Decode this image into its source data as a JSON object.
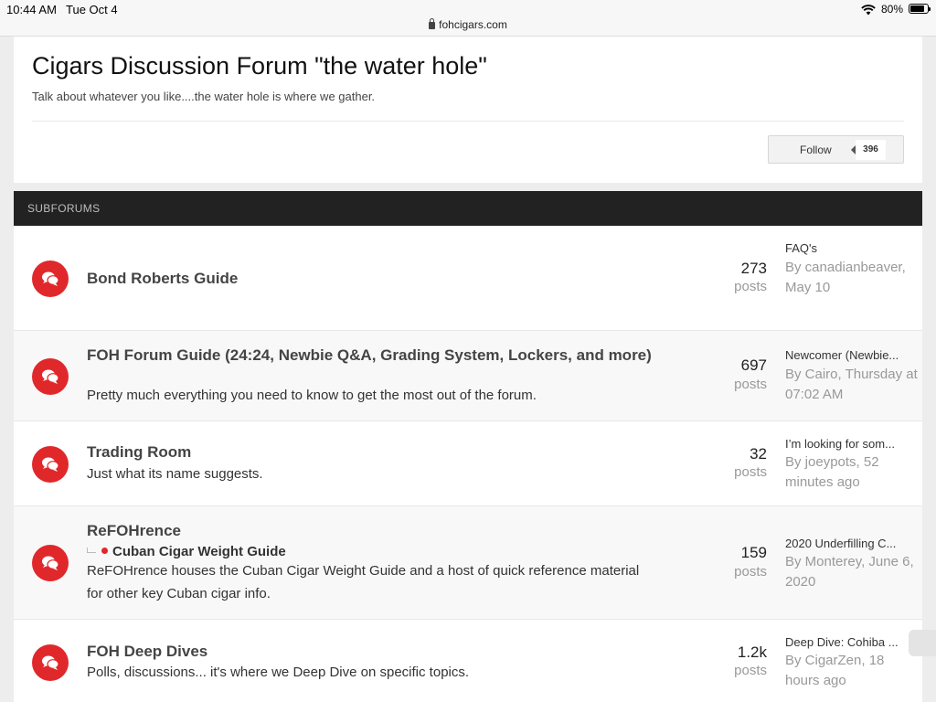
{
  "status_bar": {
    "time": "10:44 AM",
    "date": "Tue Oct 4",
    "url": "fohcigars.com",
    "battery": "80%"
  },
  "forum": {
    "title": "Cigars Discussion Forum \"the water hole\"",
    "description": "Talk about whatever you like....the water hole is where we gather.",
    "follow_label": "Follow",
    "follow_count": "396"
  },
  "subforums_heading": "SUBFORUMS",
  "rows": [
    {
      "title": "Bond Roberts Guide",
      "count": "273",
      "count_label": "posts",
      "last_title": "FAQ's",
      "last_meta": "By canadianbeaver, May 10"
    },
    {
      "title": "FOH Forum Guide (24:24, Newbie Q&A, Grading System, Lockers, and more)",
      "description": "Pretty much everything you need to know to get the most out of the forum.",
      "count": "697",
      "count_label": "posts",
      "last_title": "Newcomer (Newbie...",
      "last_meta": "By Cairo, Thursday at 07:02 AM"
    },
    {
      "title": "Trading Room",
      "description": "Just what its name suggests.",
      "count": "32",
      "count_label": "posts",
      "last_title": "I’m looking for som...",
      "last_meta": "By joeypots, 52 minutes ago"
    },
    {
      "title": "ReFOHrence",
      "sub_link": "Cuban Cigar Weight Guide",
      "description": "ReFOHrence houses the Cuban Cigar Weight Guide and a host of quick reference material for other key Cuban cigar info.",
      "count": "159",
      "count_label": "posts",
      "last_title": "2020 Underfilling C...",
      "last_meta": "By Monterey, June 6, 2020"
    },
    {
      "title": "FOH Deep Dives",
      "description": "Polls, discussions... it's where we Deep Dive on specific topics.",
      "count": "1.2k",
      "count_label": "posts",
      "last_title": "Deep Dive: Cohiba ...",
      "last_meta": "By CigarZen, 18 hours ago"
    }
  ]
}
